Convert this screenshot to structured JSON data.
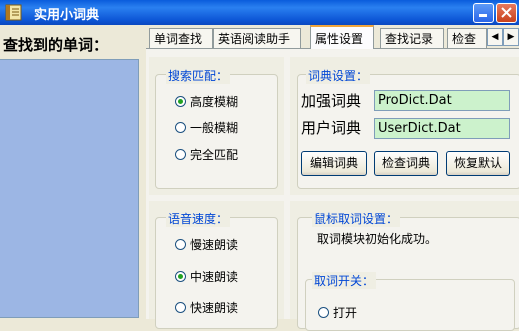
{
  "window": {
    "title": "实用小词典"
  },
  "left": {
    "found_label": "查找到的单词："
  },
  "tabs": [
    {
      "label": "单词查找"
    },
    {
      "label": "英语阅读助手"
    },
    {
      "label": "属性设置"
    },
    {
      "label": "查找记录"
    },
    {
      "label": "检查"
    }
  ],
  "search_match": {
    "title": "搜索匹配：",
    "options": [
      "高度模糊",
      "一般模糊",
      "完全匹配"
    ],
    "selected": "高度模糊"
  },
  "dict_settings": {
    "title": "词典设置：",
    "enhanced_label": "加强词典",
    "enhanced_value": "ProDict.Dat",
    "user_label": "用户词典",
    "user_value": "UserDict.Dat",
    "edit_btn": "编辑词典",
    "check_btn": "检查词典",
    "restore_btn": "恢复默认"
  },
  "speech_speed": {
    "title": "语音速度：",
    "options": [
      "慢速朗读",
      "中速朗读",
      "快速朗读"
    ],
    "selected": "中速朗读"
  },
  "mouse_settings": {
    "title": "鼠标取词设置：",
    "status": "取词模块初始化成功。",
    "switch_title": "取词开关：",
    "open_label": "打开"
  },
  "colors": {
    "accent": "#0046d5",
    "list_bg": "#9cb6e4",
    "field_bg": "#ccf2cc"
  }
}
